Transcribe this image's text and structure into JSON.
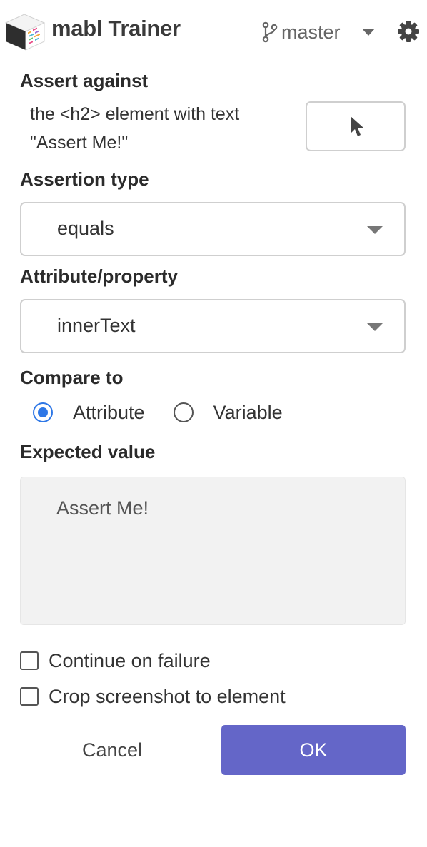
{
  "header": {
    "title": "mabl Trainer",
    "branch": "master",
    "icons": {
      "logo": "mabl-logo",
      "branch": "git-branch-icon",
      "caret": "caret-down-icon",
      "settings": "gear-icon"
    }
  },
  "assert_against": {
    "label": "Assert against",
    "target_line1": "the <h2> element with text",
    "target_line2": "\"Assert Me!\"",
    "picker_icon": "cursor-icon"
  },
  "assertion_type": {
    "label": "Assertion type",
    "value": "equals"
  },
  "attribute": {
    "label": "Attribute/property",
    "value": "innerText"
  },
  "compare_to": {
    "label": "Compare to",
    "options": [
      {
        "label": "Attribute",
        "checked": true
      },
      {
        "label": "Variable",
        "checked": false
      }
    ]
  },
  "expected": {
    "label": "Expected value",
    "value": "Assert Me!"
  },
  "options": {
    "continue_on_failure": {
      "label": "Continue on failure",
      "checked": false
    },
    "crop_screenshot": {
      "label": "Crop screenshot to element",
      "checked": false
    }
  },
  "actions": {
    "cancel_label": "Cancel",
    "ok_label": "OK"
  },
  "colors": {
    "accent": "#6466c8",
    "radio": "#2e77e6",
    "input_border": "#cfcfcf",
    "disabled_bg": "#f2f2f2"
  }
}
